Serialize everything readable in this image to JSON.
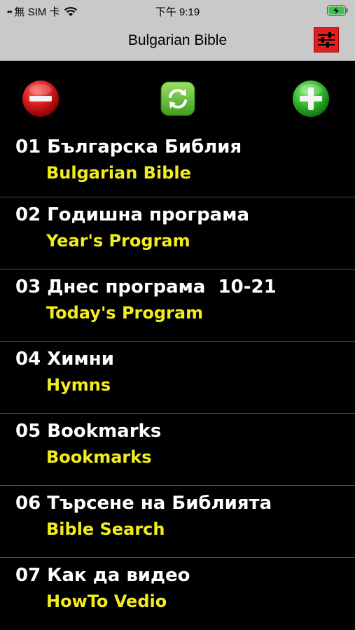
{
  "status_bar": {
    "carrier": "無 SIM 卡",
    "time": "下午 9:19",
    "wifi_icon": "wifi-icon",
    "battery_icon": "battery-charging-icon"
  },
  "nav": {
    "title": "Bulgarian Bible",
    "settings_icon": "sliders-icon"
  },
  "toolbar": {
    "remove_icon": "minus-circle-icon",
    "refresh_icon": "refresh-icon",
    "add_icon": "plus-circle-icon"
  },
  "items": [
    {
      "title": "01 Българска Библия",
      "subtitle": "Bulgarian Bible"
    },
    {
      "title": "02 Годишна програма",
      "subtitle": "Year's Program"
    },
    {
      "title": "03 Днес програма  10-21",
      "subtitle": "Today's Program"
    },
    {
      "title": "04 Химни",
      "subtitle": "Hymns"
    },
    {
      "title": "05 Bookmarks",
      "subtitle": "Bookmarks"
    },
    {
      "title": "06 Търсене на Библията",
      "subtitle": "Bible Search"
    },
    {
      "title": "07 Как да видео",
      "subtitle": "HowTo Vedio"
    }
  ],
  "colors": {
    "title_text": "#ffffff",
    "subtitle_text": "#f1ee1e",
    "separator": "#6b4a35",
    "bar_background": "#c9c9c9",
    "settings_red": "#e02020"
  }
}
